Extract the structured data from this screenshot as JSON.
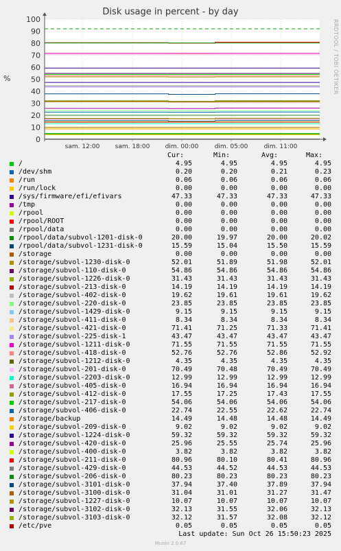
{
  "chart_data": {
    "type": "line",
    "title": "Disk usage in percent - by day",
    "ylabel": "%",
    "side_label": "RRDTOOL / TOBI OETIKER",
    "ylim": [
      0,
      100
    ],
    "yticks": [
      0,
      10,
      20,
      30,
      40,
      50,
      60,
      70,
      80,
      90,
      100
    ],
    "xticks": [
      "sam. 12:00",
      "sam. 18:00",
      "dim. 00:00",
      "dim. 05:00",
      "dim. 11:00"
    ],
    "warning_line": 92,
    "critical_line": 98,
    "columns": [
      "Cur:",
      "Min:",
      "Avg:",
      "Max:"
    ],
    "series": [
      {
        "name": "/",
        "color": "#00cc00",
        "cur": "4.95",
        "min": "4.95",
        "avg": "4.95",
        "max": "4.95"
      },
      {
        "name": "/dev/shm",
        "color": "#0066b3",
        "cur": "0.20",
        "min": "0.20",
        "avg": "0.21",
        "max": "0.23"
      },
      {
        "name": "/run",
        "color": "#ff8000",
        "cur": "0.06",
        "min": "0.06",
        "avg": "0.06",
        "max": "0.06"
      },
      {
        "name": "/run/lock",
        "color": "#ffcc00",
        "cur": "0.00",
        "min": "0.00",
        "avg": "0.00",
        "max": "0.00"
      },
      {
        "name": "/sys/firmware/efi/efivars",
        "color": "#330099",
        "cur": "47.33",
        "min": "47.33",
        "avg": "47.33",
        "max": "47.33"
      },
      {
        "name": "/tmp",
        "color": "#990099",
        "cur": "0.00",
        "min": "0.00",
        "avg": "0.00",
        "max": "0.00"
      },
      {
        "name": "/rpool",
        "color": "#ccff00",
        "cur": "0.00",
        "min": "0.00",
        "avg": "0.00",
        "max": "0.00"
      },
      {
        "name": "/rpool/ROOT",
        "color": "#ff0000",
        "cur": "0.00",
        "min": "0.00",
        "avg": "0.00",
        "max": "0.00"
      },
      {
        "name": "/rpool/data",
        "color": "#808080",
        "cur": "0.00",
        "min": "0.00",
        "avg": "0.00",
        "max": "0.00"
      },
      {
        "name": "/rpool/data/subvol-1201-disk-0",
        "color": "#008f00",
        "cur": "20.00",
        "min": "19.97",
        "avg": "20.00",
        "max": "20.02"
      },
      {
        "name": "/rpool/data/subvol-1231-disk-0",
        "color": "#00487d",
        "cur": "15.59",
        "min": "15.04",
        "avg": "15.50",
        "max": "15.59"
      },
      {
        "name": "/storage",
        "color": "#b35a00",
        "cur": "0.00",
        "min": "0.00",
        "avg": "0.00",
        "max": "0.00"
      },
      {
        "name": "/storage/subvol-1230-disk-0",
        "color": "#b38f00",
        "cur": "52.01",
        "min": "51.89",
        "avg": "51.98",
        "max": "52.01"
      },
      {
        "name": "/storage/subvol-110-disk-0",
        "color": "#6b006b",
        "cur": "54.86",
        "min": "54.86",
        "avg": "54.86",
        "max": "54.86"
      },
      {
        "name": "/storage/subvol-1226-disk-0",
        "color": "#8fb300",
        "cur": "31.43",
        "min": "31.43",
        "avg": "31.43",
        "max": "31.43"
      },
      {
        "name": "/storage/subvol-213-disk-0",
        "color": "#b30000",
        "cur": "14.19",
        "min": "14.19",
        "avg": "14.19",
        "max": "14.19"
      },
      {
        "name": "/storage/subvol-402-disk-0",
        "color": "#bebebe",
        "cur": "19.62",
        "min": "19.61",
        "avg": "19.61",
        "max": "19.62"
      },
      {
        "name": "/storage/subvol-220-disk-0",
        "color": "#80ff80",
        "cur": "23.85",
        "min": "23.85",
        "avg": "23.85",
        "max": "23.85"
      },
      {
        "name": "/storage/subvol-1429-disk-0",
        "color": "#80c9ff",
        "cur": "9.15",
        "min": "9.15",
        "avg": "9.15",
        "max": "9.15"
      },
      {
        "name": "/storage/subvol-411-disk-0",
        "color": "#ffc080",
        "cur": "8.34",
        "min": "8.34",
        "avg": "8.34",
        "max": "8.34"
      },
      {
        "name": "/storage/subvol-421-disk-0",
        "color": "#ffe680",
        "cur": "71.41",
        "min": "71.25",
        "avg": "71.33",
        "max": "71.41"
      },
      {
        "name": "/storage/subvol-225-disk-1",
        "color": "#aa80ff",
        "cur": "43.47",
        "min": "43.47",
        "avg": "43.47",
        "max": "43.47"
      },
      {
        "name": "/storage/subvol-1211-disk-0",
        "color": "#ee00cc",
        "cur": "71.55",
        "min": "71.55",
        "avg": "71.55",
        "max": "71.55"
      },
      {
        "name": "/storage/subvol-418-disk-0",
        "color": "#ff8080",
        "cur": "52.76",
        "min": "52.76",
        "avg": "52.86",
        "max": "52.92"
      },
      {
        "name": "/storage/subvol-1212-disk-0",
        "color": "#666600",
        "cur": "4.35",
        "min": "4.35",
        "avg": "4.35",
        "max": "4.35"
      },
      {
        "name": "/storage/subvol-201-disk-0",
        "color": "#ffbfff",
        "cur": "70.49",
        "min": "70.48",
        "avg": "70.49",
        "max": "70.49"
      },
      {
        "name": "/storage/subvol-2203-disk-0",
        "color": "#00ffcc",
        "cur": "12.99",
        "min": "12.99",
        "avg": "12.99",
        "max": "12.99"
      },
      {
        "name": "/storage/subvol-405-disk-0",
        "color": "#cc6699",
        "cur": "16.94",
        "min": "16.94",
        "avg": "16.94",
        "max": "16.94"
      },
      {
        "name": "/storage/subvol-412-disk-0",
        "color": "#999900",
        "cur": "17.55",
        "min": "17.25",
        "avg": "17.43",
        "max": "17.55"
      },
      {
        "name": "/storage/subvol-217-disk-0",
        "color": "#00cc00",
        "cur": "54.06",
        "min": "54.06",
        "avg": "54.06",
        "max": "54.06"
      },
      {
        "name": "/storage/subvol-406-disk-0",
        "color": "#0066b3",
        "cur": "22.74",
        "min": "22.55",
        "avg": "22.62",
        "max": "22.74"
      },
      {
        "name": "/storage/backup",
        "color": "#ff8000",
        "cur": "14.49",
        "min": "14.48",
        "avg": "14.48",
        "max": "14.49"
      },
      {
        "name": "/storage/subvol-209-disk-0",
        "color": "#ffcc00",
        "cur": "9.02",
        "min": "9.02",
        "avg": "9.02",
        "max": "9.02"
      },
      {
        "name": "/storage/subvol-1224-disk-0",
        "color": "#330099",
        "cur": "59.32",
        "min": "59.32",
        "avg": "59.32",
        "max": "59.32"
      },
      {
        "name": "/storage/subvol-420-disk-0",
        "color": "#990099",
        "cur": "25.96",
        "min": "25.55",
        "avg": "25.74",
        "max": "25.96"
      },
      {
        "name": "/storage/subvol-400-disk-0",
        "color": "#ccff00",
        "cur": "3.82",
        "min": "3.82",
        "avg": "3.82",
        "max": "3.82"
      },
      {
        "name": "/storage/subvol-211-disk-0",
        "color": "#ff0000",
        "cur": "80.96",
        "min": "80.10",
        "avg": "80.41",
        "max": "80.96"
      },
      {
        "name": "/storage/subvol-429-disk-0",
        "color": "#808080",
        "cur": "44.53",
        "min": "44.52",
        "avg": "44.53",
        "max": "44.53"
      },
      {
        "name": "/storage/subvol-206-disk-0",
        "color": "#008f00",
        "cur": "80.23",
        "min": "80.23",
        "avg": "80.23",
        "max": "80.23"
      },
      {
        "name": "/storage/subvol-3101-disk-0",
        "color": "#00487d",
        "cur": "37.94",
        "min": "37.40",
        "avg": "37.89",
        "max": "37.94"
      },
      {
        "name": "/storage/subvol-3100-disk-0",
        "color": "#b35a00",
        "cur": "31.04",
        "min": "31.01",
        "avg": "31.27",
        "max": "31.47"
      },
      {
        "name": "/storage/subvol-1227-disk-0",
        "color": "#b38f00",
        "cur": "10.07",
        "min": "10.07",
        "avg": "10.07",
        "max": "10.07"
      },
      {
        "name": "/storage/subvol-3102-disk-0",
        "color": "#6b006b",
        "cur": "32.13",
        "min": "31.55",
        "avg": "32.06",
        "max": "32.13"
      },
      {
        "name": "/storage/subvol-3103-disk-0",
        "color": "#8fb300",
        "cur": "32.12",
        "min": "31.57",
        "avg": "32.08",
        "max": "32.12"
      },
      {
        "name": "/etc/pve",
        "color": "#b30000",
        "cur": "0.05",
        "min": "0.05",
        "avg": "0.05",
        "max": "0.05"
      }
    ]
  },
  "footer": {
    "last_update": "Last update: Sun Oct 26 15:50:23 2025",
    "munin": "Munin 2.0.67"
  }
}
